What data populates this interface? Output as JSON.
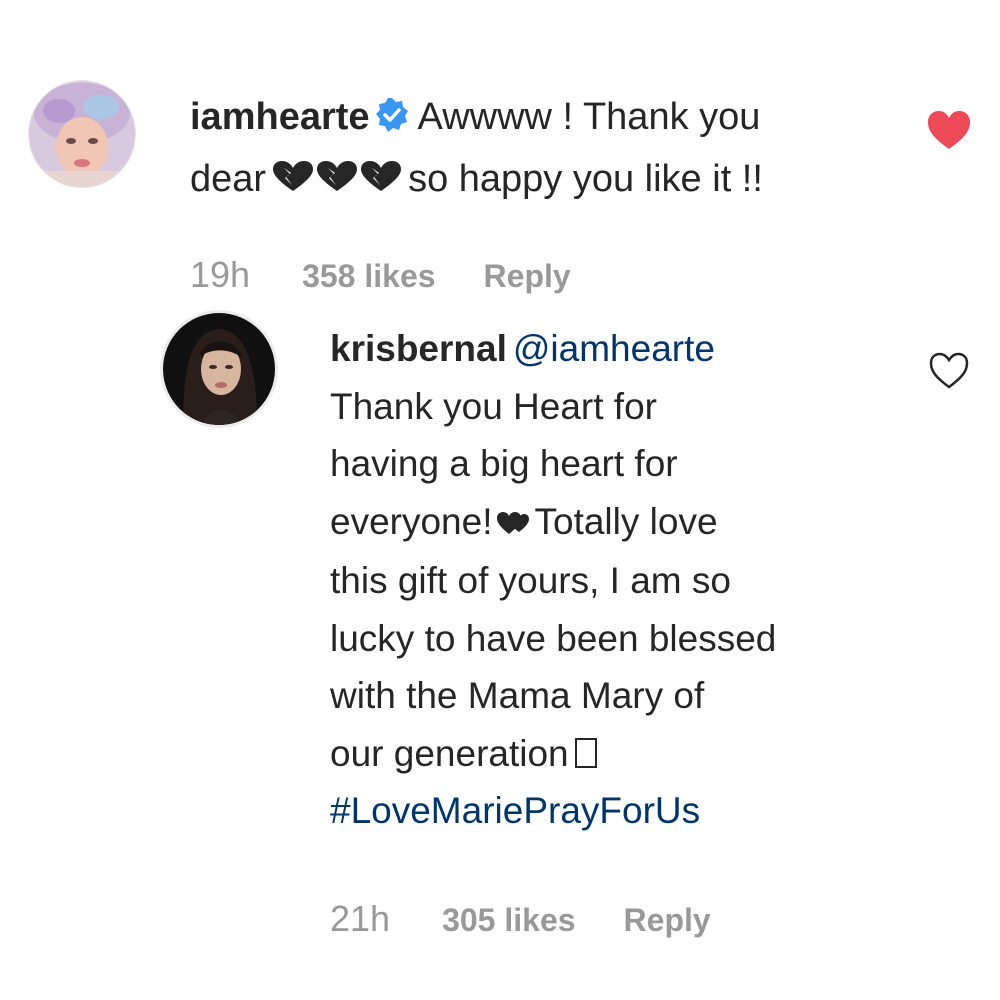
{
  "comments": [
    {
      "username": "iamhearte",
      "verified": true,
      "text_line1": "Awwww ! Thank you",
      "text_line2_prefix": "dear",
      "text_line2_suffix": "so happy you like it !!",
      "time": "19h",
      "likes": "358 likes",
      "reply_label": "Reply",
      "liked": true,
      "avatar": "avatar-iamhearte",
      "colors": {
        "like": "#ed4956"
      }
    },
    {
      "username": "krisbernal",
      "mention": "@iamhearte",
      "lines": [
        "Thank you Heart for",
        "having a big heart for",
        "everyone!",
        "Totally love",
        "this gift of yours, I am so",
        "lucky to have been blessed",
        "with the Mama Mary of",
        "our generation"
      ],
      "hashtag": "#LoveMariePrayForUs",
      "time": "21h",
      "likes": "305 likes",
      "reply_label": "Reply",
      "liked": false,
      "avatar": "avatar-krisbernal"
    }
  ],
  "icons": {
    "verified": "verified-badge-icon",
    "heart_filled": "heart-filled-icon",
    "heart_outline": "heart-outline-icon",
    "broken_hearts": "black-hearts-emoji",
    "black_heart": "black-heart-emoji"
  },
  "colors": {
    "text": "#262626",
    "muted": "#999999",
    "link": "#003569",
    "verified": "#3897f0",
    "like_red": "#ed4956"
  }
}
